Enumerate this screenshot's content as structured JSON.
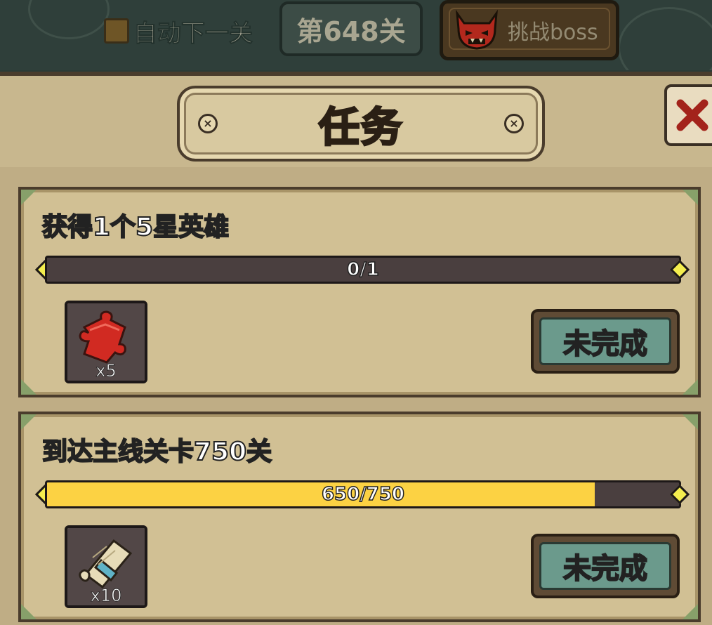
{
  "topbar": {
    "auto_next_label": "自动下一关",
    "auto_next_checked": false,
    "stage_label": "第648关",
    "boss_label": "挑战boss",
    "boss_icon": "monster-face-icon"
  },
  "dialog": {
    "title": "任务",
    "close_icon": "close-x-icon"
  },
  "colors": {
    "progress_fill": "#fcd243",
    "progress_track": "#4a3f3f",
    "button_face": "#6b9a8c",
    "panel_bg": "#bfad85",
    "reward_border_red": "#e8505b",
    "reward_border_green": "#5ad35a"
  },
  "tasks": [
    {
      "title": "获得1个5星英雄",
      "progress_text": "0/1",
      "progress_fraction": 0,
      "reward_icon": "red-puzzle-piece-icon",
      "reward_qty": "x5",
      "reward_border": "#e8505b",
      "status_label": "未完成"
    },
    {
      "title": "到达主线关卡750关",
      "progress_text": "650/750",
      "progress_fraction": 0.8667,
      "reward_icon": "scroll-icon",
      "reward_qty": "x10",
      "reward_border": "#5ad35a",
      "status_label": "未完成"
    }
  ]
}
